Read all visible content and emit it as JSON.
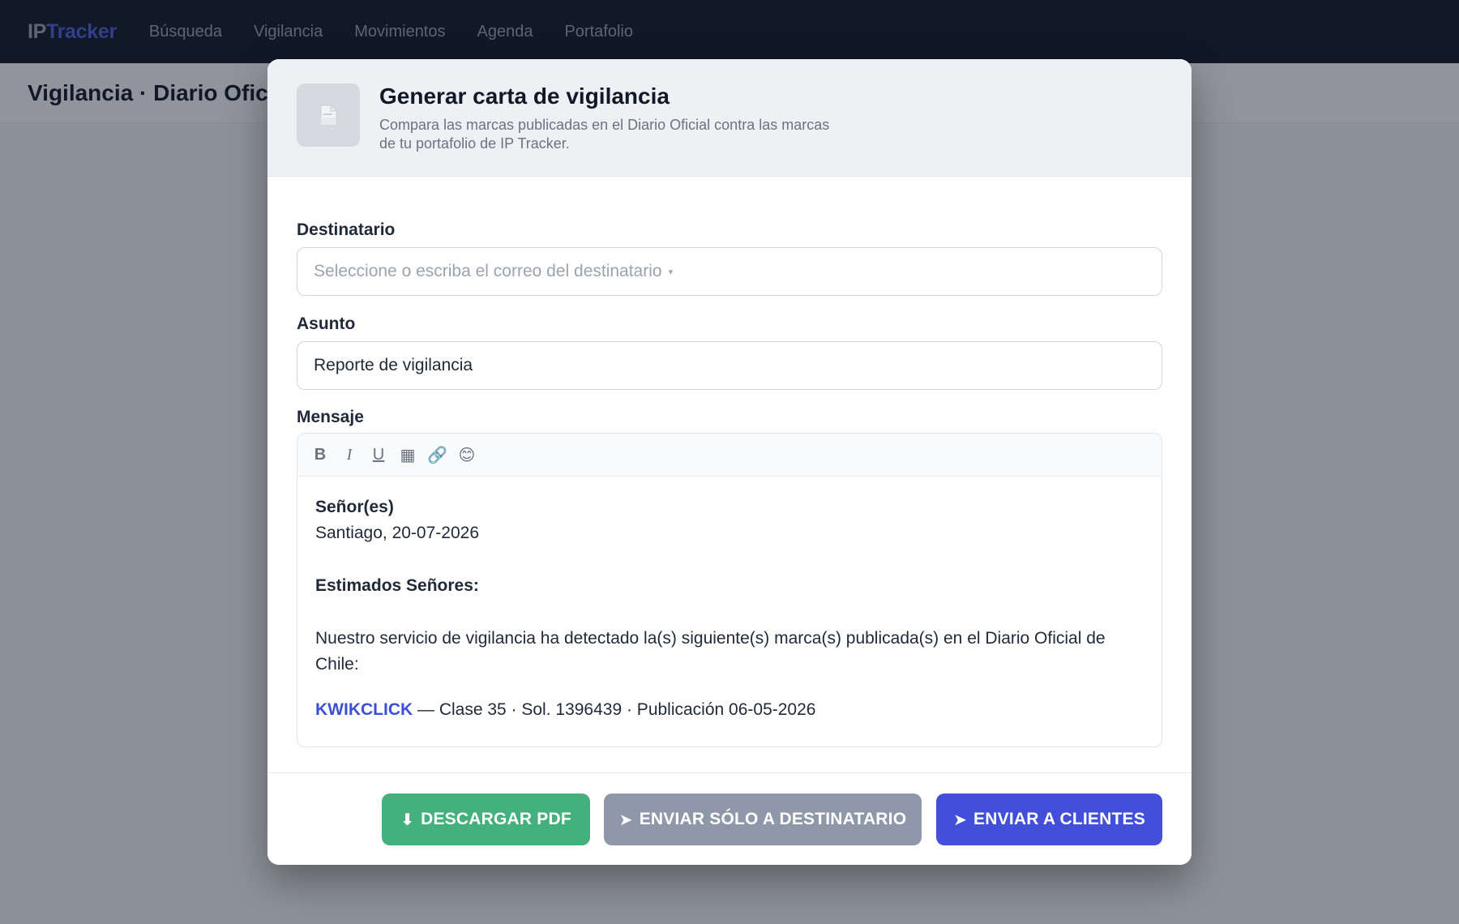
{
  "nav": {
    "brand_a": "IP",
    "brand_b": "Tracker",
    "items": [
      "Búsqueda",
      "Vigilancia",
      "Movimientos",
      "Agenda",
      "Portafolio"
    ]
  },
  "page": {
    "title": "Vigilancia · Diario Oficial"
  },
  "modal": {
    "title": "Generar carta de vigilancia",
    "subtitle_line1": "Compara las marcas publicadas en el Diario Oficial contra las marcas",
    "subtitle_line2": "de tu portafolio de IP Tracker.",
    "recipient": {
      "label": "Destinatario",
      "placeholder": "Seleccione o escriba el correo del destinatario",
      "caret": "▾"
    },
    "subject": {
      "label": "Asunto",
      "value": "Reporte de vigilancia"
    },
    "message": {
      "label": "Mensaje",
      "toolbar": {
        "bold": "B",
        "italic": "I",
        "underline": "U",
        "table": "▦",
        "link": "🔗",
        "emoji": "😊"
      },
      "salutation": "Señor(es)",
      "place_date": "Santiago, 20-07-2026",
      "greeting": "Estimados Señores:",
      "body_line1": "Nuestro servicio de vigilancia ha detectado la(s) siguiente(s) marca(s) publicada(s) en el Diario Oficial de",
      "body_line2": "Chile:",
      "mark_name": "KWIKCLICK",
      "mark_details": " — Clase 35 · Sol. 1396439 · Publicación 06-05-2026"
    },
    "buttons": {
      "download_pdf": "DESCARGAR PDF",
      "download_glyph": "⬇",
      "send_recipient": "ENVIAR SÓLO A DESTINATARIO",
      "send_clients": "ENVIAR A CLIENTES",
      "send_glyph": "➤"
    }
  },
  "colors": {
    "nav_bg": "#111827",
    "accent": "#4250d9",
    "download": "#44b07e",
    "secondary": "#8f98a8"
  }
}
